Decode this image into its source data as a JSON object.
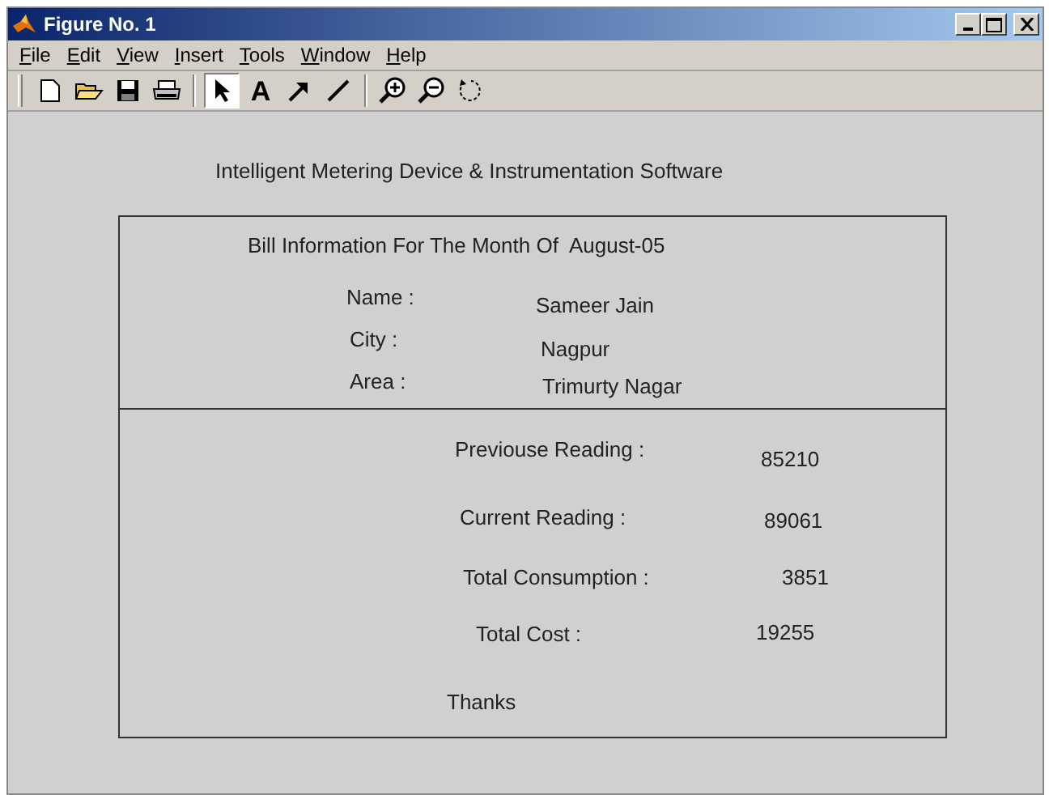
{
  "window": {
    "title": "Figure No. 1"
  },
  "menu": [
    "File",
    "Edit",
    "View",
    "Insert",
    "Tools",
    "Window",
    "Help"
  ],
  "toolbar": [
    [
      {
        "kind": "new",
        "selected": false
      },
      {
        "kind": "open",
        "selected": false
      },
      {
        "kind": "save",
        "selected": false
      },
      {
        "kind": "print",
        "selected": false
      }
    ],
    [
      {
        "kind": "pointer",
        "selected": true
      },
      {
        "kind": "text",
        "label": "A",
        "selected": false
      },
      {
        "kind": "arrow",
        "selected": false
      },
      {
        "kind": "line",
        "selected": false
      }
    ],
    [
      {
        "kind": "zoom-in",
        "selected": false
      },
      {
        "kind": "zoom-out",
        "selected": false
      },
      {
        "kind": "rotate",
        "selected": false
      }
    ]
  ],
  "heading": "Intelligent Metering Device & Instrumentation Software",
  "bill": {
    "title": "Bill Information For The Month Of  August-05",
    "customer": [
      {
        "label": "Name :",
        "value": "Sameer Jain"
      },
      {
        "label": "City :",
        "value": "Nagpur"
      },
      {
        "label": "Area :",
        "value": "Trimurty Nagar"
      }
    ],
    "readings": [
      {
        "label": "Previouse Reading :",
        "value": "85210"
      },
      {
        "label": "Current Reading :",
        "value": "89061"
      },
      {
        "label": "Total Consumption :",
        "value": "3851"
      },
      {
        "label": "Total Cost :",
        "value": "19255"
      }
    ],
    "footer": "Thanks"
  }
}
